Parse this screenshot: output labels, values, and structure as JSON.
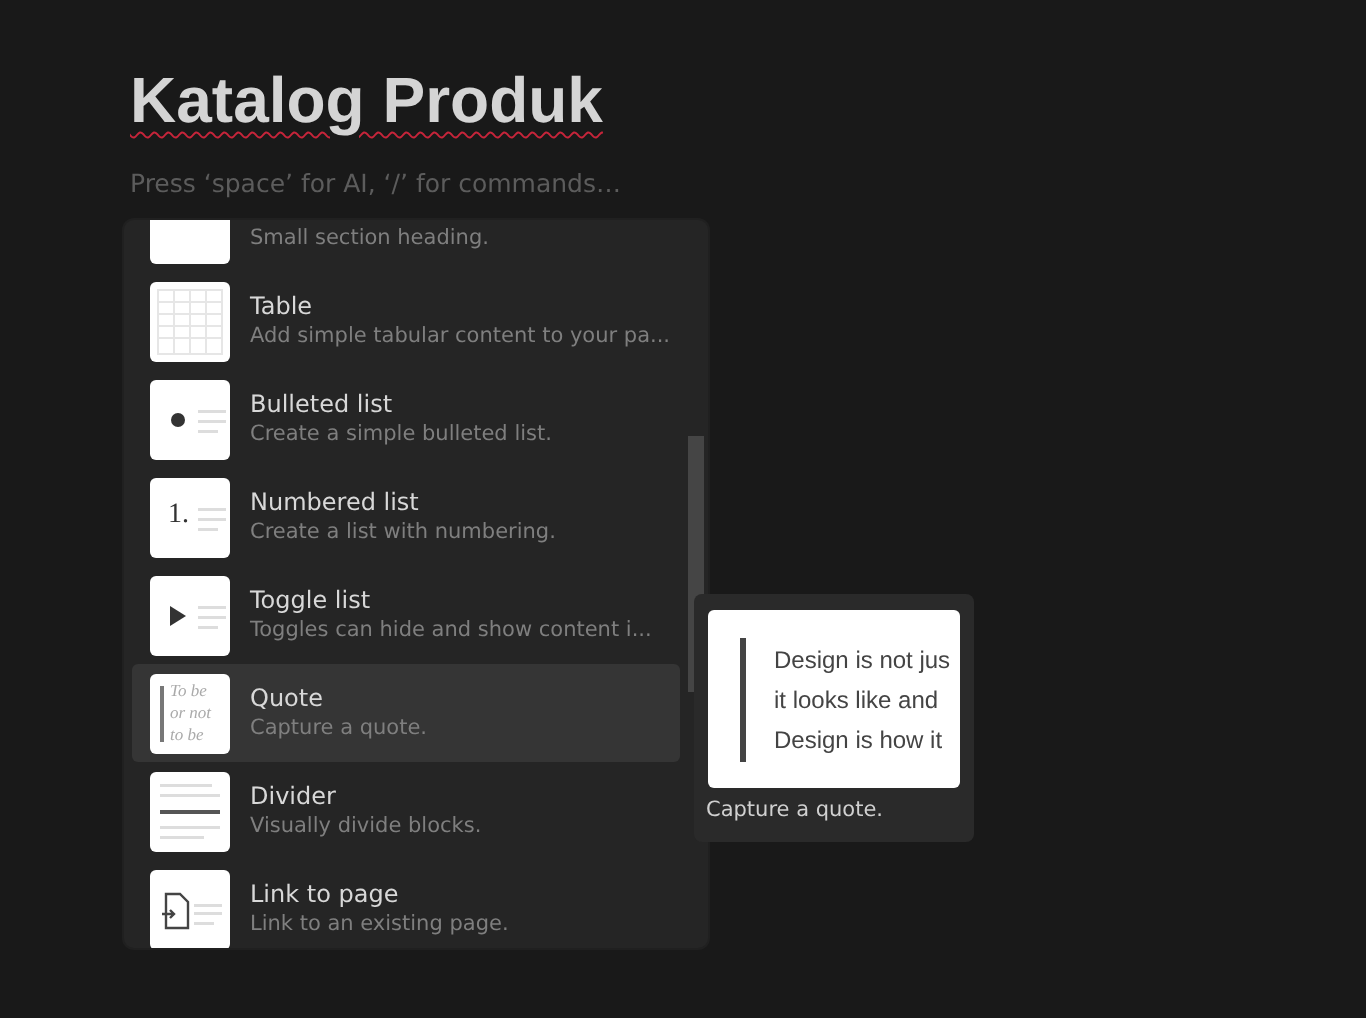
{
  "page": {
    "title": "Katalog Produk",
    "placeholder": "Press ‘space’ for AI, ‘/’ for commands…"
  },
  "menu": {
    "items": [
      {
        "kind": "heading",
        "description": "Small section heading.",
        "selected": false
      },
      {
        "kind": "table",
        "title": "Table",
        "description": "Add simple tabular content to your pa...",
        "selected": false
      },
      {
        "kind": "bullet",
        "title": "Bulleted list",
        "description": "Create a simple bulleted list.",
        "selected": false
      },
      {
        "kind": "number",
        "title": "Numbered list",
        "description": "Create a list with numbering.",
        "icon_text": "1.",
        "selected": false
      },
      {
        "kind": "toggle",
        "title": "Toggle list",
        "description": "Toggles can hide and show content i...",
        "selected": false
      },
      {
        "kind": "quote",
        "title": "Quote",
        "description": "Capture a quote.",
        "icon_text": "To be or not to be",
        "selected": true
      },
      {
        "kind": "divider",
        "title": "Divider",
        "description": "Visually divide blocks.",
        "selected": false
      },
      {
        "kind": "link",
        "title": "Link to page",
        "description": "Link to an existing page.",
        "selected": false
      }
    ]
  },
  "preview": {
    "lines": [
      "Design is not jus",
      "it looks like and",
      "Design is how it"
    ],
    "caption": "Capture a quote."
  }
}
